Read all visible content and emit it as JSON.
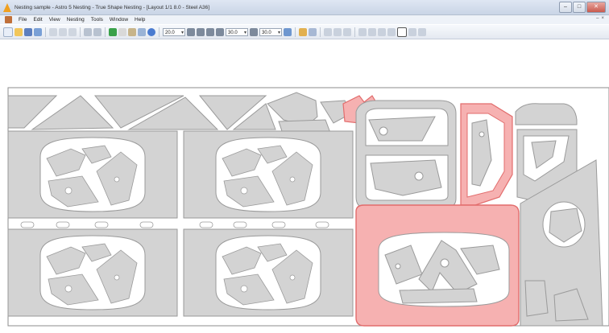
{
  "window": {
    "title": "Nesting sample - Astro 5 Nesting - True Shape Nesting - [Layout 1/1 8.0 - Steel A36]",
    "minimize_glyph": "–",
    "maximize_glyph": "□",
    "close_glyph": "✕"
  },
  "menu": {
    "items": [
      "File",
      "Edit",
      "View",
      "Nesting",
      "Tools",
      "Window",
      "Help"
    ],
    "mdi_minimize": "–",
    "mdi_close": "×"
  },
  "toolbar": {
    "combo_1": "20.0",
    "combo_2": "30.0",
    "combo_3": "30.0"
  },
  "colors": {
    "part_fill": "#d3d3d3",
    "part_stroke": "#9a9a9a",
    "highlight_fill": "#f6b1b1",
    "highlight_stroke": "#e26c6c",
    "sheet_border": "#8c8c8c"
  }
}
